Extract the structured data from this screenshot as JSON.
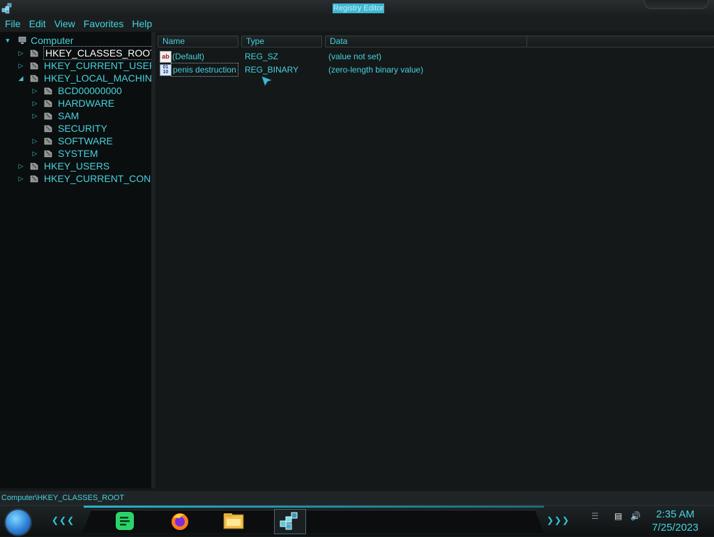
{
  "window": {
    "title": "Registry Editor",
    "icon": "registry-editor-icon"
  },
  "menu": [
    "File",
    "Edit",
    "View",
    "Favorites",
    "Help"
  ],
  "tree": {
    "root": "Computer",
    "items": [
      {
        "label": "HKEY_CLASSES_ROOT",
        "level": 1,
        "expander": "collapsed",
        "selected": true
      },
      {
        "label": "HKEY_CURRENT_USER",
        "level": 1,
        "expander": "collapsed"
      },
      {
        "label": "HKEY_LOCAL_MACHINE",
        "level": 1,
        "expander": "expanded"
      },
      {
        "label": "BCD00000000",
        "level": 2,
        "expander": "collapsed"
      },
      {
        "label": "HARDWARE",
        "level": 2,
        "expander": "collapsed"
      },
      {
        "label": "SAM",
        "level": 2,
        "expander": "collapsed"
      },
      {
        "label": "SECURITY",
        "level": 2,
        "expander": "none"
      },
      {
        "label": "SOFTWARE",
        "level": 2,
        "expander": "collapsed"
      },
      {
        "label": "SYSTEM",
        "level": 2,
        "expander": "collapsed"
      },
      {
        "label": "HKEY_USERS",
        "level": 1,
        "expander": "collapsed"
      },
      {
        "label": "HKEY_CURRENT_CONFI",
        "level": 1,
        "expander": "collapsed"
      }
    ]
  },
  "columns": [
    "Name",
    "Type",
    "Data"
  ],
  "values": [
    {
      "icon": "string-value-icon",
      "icon_text": "ab",
      "name": "(Default)",
      "type": "REG_SZ",
      "data": "(value not set)"
    },
    {
      "icon": "binary-value-icon",
      "icon_text": "01 10",
      "name": "penis destruction",
      "type": "REG_BINARY",
      "data": "(zero-length binary value)",
      "focused": true
    }
  ],
  "status": {
    "path": "Computer\\HKEY_CLASSES_ROOT"
  },
  "taskbar": {
    "apps": [
      {
        "name": "notes-app-icon",
        "color": "#2bd46a"
      },
      {
        "name": "firefox-icon",
        "color": "#ff7a1a"
      },
      {
        "name": "file-explorer-icon",
        "color": "#f2c04a"
      },
      {
        "name": "registry-editor-task-icon",
        "color": "#58c8e0",
        "active": true
      }
    ],
    "tray_icons": [
      "network-icon",
      "volume-icon"
    ],
    "clock": {
      "time": "2:35 AM",
      "date": "7/25/2023"
    }
  },
  "colors": {
    "accent": "#46d3e0",
    "background": "#141818",
    "tree_background": "#0b0e0e"
  }
}
